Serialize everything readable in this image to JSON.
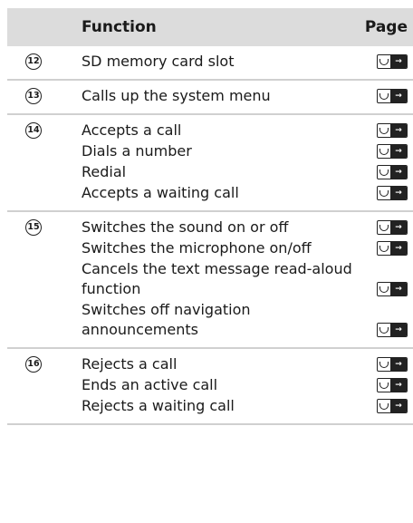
{
  "header": {
    "number_col": "",
    "function_col": "Function",
    "page_col": "Page"
  },
  "groups": [
    {
      "number": "12",
      "rows": [
        {
          "text": "SD memory card slot"
        }
      ]
    },
    {
      "number": "13",
      "rows": [
        {
          "text": "Calls up the system menu"
        }
      ]
    },
    {
      "number": "14",
      "rows": [
        {
          "text": "Accepts a call"
        },
        {
          "text": "Dials a number"
        },
        {
          "text": "Redial"
        },
        {
          "text": "Accepts a waiting call"
        }
      ]
    },
    {
      "number": "15",
      "rows": [
        {
          "text": "Switches the sound on or off"
        },
        {
          "text": "Switches the microphone on/off"
        },
        {
          "text": "Cancels the text message read-aloud function"
        },
        {
          "text": "Switches off navigation announcements"
        }
      ]
    },
    {
      "number": "16",
      "rows": [
        {
          "text": "Rejects a call"
        },
        {
          "text": "Ends an active call"
        },
        {
          "text": "Rejects a waiting call"
        }
      ]
    }
  ],
  "icon": "page-reference-icon"
}
